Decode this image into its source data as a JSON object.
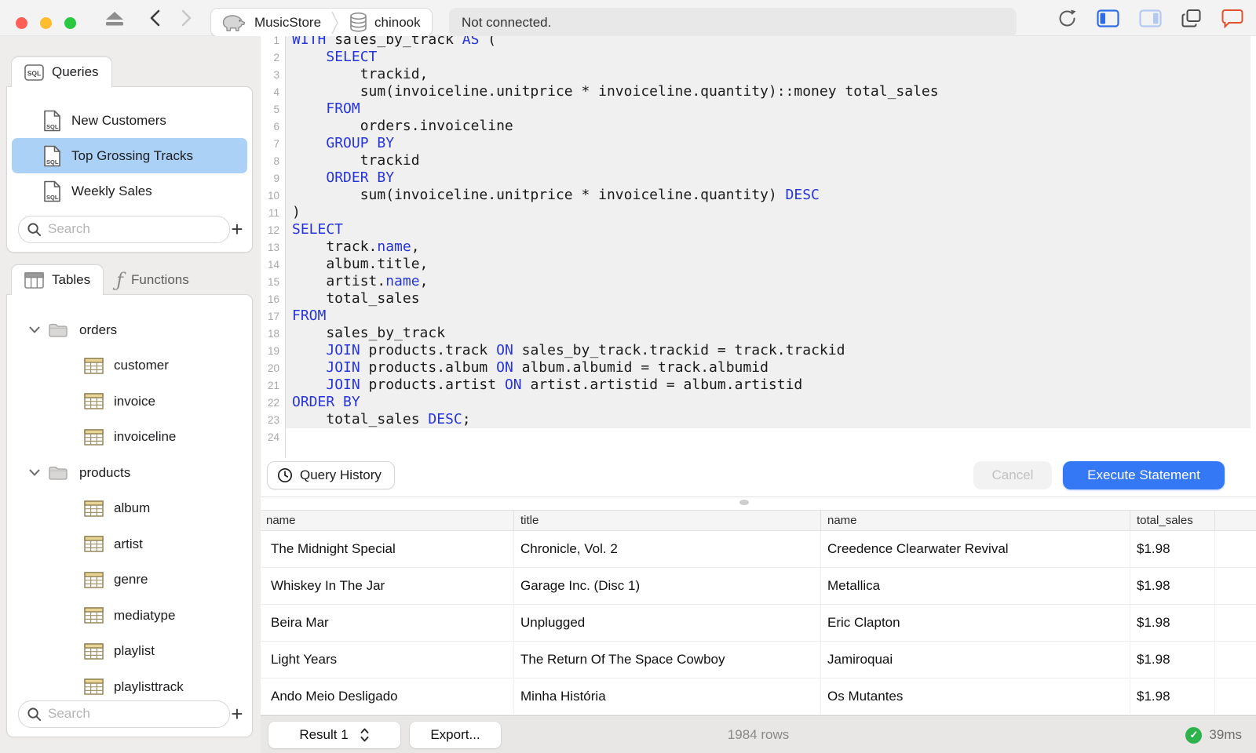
{
  "colors": {
    "accent": "#3478f6",
    "selection_blue": "#abd2f6",
    "keyword_blue": "#2635d9",
    "chat_orange": "#e1512e",
    "success_green": "#2eb24c",
    "traffic_red": "#ff5f57",
    "traffic_yellow": "#febc2e",
    "traffic_green": "#28c840",
    "table_icon_tan": "#e9d597",
    "table_icon_border": "#8e7e4e"
  },
  "titlebar": {
    "breadcrumb": {
      "server": "MusicStore",
      "database": "chinook"
    },
    "status": "Not connected."
  },
  "sidebar": {
    "queries": {
      "tab_label": "Queries",
      "tab_icon": "sql-badge-icon",
      "items": [
        {
          "label": "New Customers",
          "selected": false
        },
        {
          "label": "Top Grossing Tracks",
          "selected": true
        },
        {
          "label": "Weekly Sales",
          "selected": false
        }
      ],
      "search_placeholder": "Search",
      "add_label": "+"
    },
    "tables": {
      "tab_label": "Tables",
      "functions_tab_label": "Functions",
      "tree": [
        {
          "kind": "folder",
          "label": "orders",
          "expanded": true
        },
        {
          "kind": "table",
          "label": "customer"
        },
        {
          "kind": "table",
          "label": "invoice"
        },
        {
          "kind": "table",
          "label": "invoiceline"
        },
        {
          "kind": "folder",
          "label": "products",
          "expanded": true
        },
        {
          "kind": "table",
          "label": "album"
        },
        {
          "kind": "table",
          "label": "artist"
        },
        {
          "kind": "table",
          "label": "genre"
        },
        {
          "kind": "table",
          "label": "mediatype"
        },
        {
          "kind": "table",
          "label": "playlist"
        },
        {
          "kind": "table",
          "label": "playlisttrack"
        }
      ],
      "search_placeholder": "Search",
      "add_label": "+"
    }
  },
  "editor": {
    "lines": [
      [
        [
          "WITH",
          1
        ],
        [
          " sales_by_track ",
          0
        ],
        [
          "AS",
          1
        ],
        [
          " (",
          0
        ]
      ],
      [
        [
          "    ",
          0
        ],
        [
          "SELECT",
          1
        ]
      ],
      [
        [
          "        trackid,",
          0
        ]
      ],
      [
        [
          "        sum(invoiceline.unitprice * invoiceline.quantity)::money total_sales",
          0
        ]
      ],
      [
        [
          "    ",
          0
        ],
        [
          "FROM",
          1
        ]
      ],
      [
        [
          "        orders.invoiceline",
          0
        ]
      ],
      [
        [
          "    ",
          0
        ],
        [
          "GROUP BY",
          1
        ]
      ],
      [
        [
          "        trackid",
          0
        ]
      ],
      [
        [
          "    ",
          0
        ],
        [
          "ORDER BY",
          1
        ]
      ],
      [
        [
          "        sum(invoiceline.unitprice * invoiceline.quantity) ",
          0
        ],
        [
          "DESC",
          1
        ]
      ],
      [
        [
          ")",
          0
        ]
      ],
      [
        [
          "SELECT",
          1
        ]
      ],
      [
        [
          "    track.",
          0
        ],
        [
          "name",
          1
        ],
        [
          ",",
          0
        ]
      ],
      [
        [
          "    album.title,",
          0
        ]
      ],
      [
        [
          "    artist.",
          0
        ],
        [
          "name",
          1
        ],
        [
          ",",
          0
        ]
      ],
      [
        [
          "    total_sales",
          0
        ]
      ],
      [
        [
          "FROM",
          1
        ]
      ],
      [
        [
          "    sales_by_track",
          0
        ]
      ],
      [
        [
          "    ",
          0
        ],
        [
          "JOIN",
          1
        ],
        [
          " products.track ",
          0
        ],
        [
          "ON",
          1
        ],
        [
          " sales_by_track.trackid = track.trackid",
          0
        ]
      ],
      [
        [
          "    ",
          0
        ],
        [
          "JOIN",
          1
        ],
        [
          " products.album ",
          0
        ],
        [
          "ON",
          1
        ],
        [
          " album.albumid = track.albumid",
          0
        ]
      ],
      [
        [
          "    ",
          0
        ],
        [
          "JOIN",
          1
        ],
        [
          " products.artist ",
          0
        ],
        [
          "ON",
          1
        ],
        [
          " artist.artistid = album.artistid",
          0
        ]
      ],
      [
        [
          "ORDER BY",
          1
        ]
      ],
      [
        [
          "    total_sales ",
          0
        ],
        [
          "DESC",
          1
        ],
        [
          ";",
          0
        ]
      ],
      []
    ],
    "query_history_label": "Query History",
    "cancel_label": "Cancel",
    "execute_label": "Execute Statement"
  },
  "results": {
    "columns": [
      "name",
      "title",
      "name",
      "total_sales"
    ],
    "rows": [
      [
        "The Midnight Special",
        "Chronicle, Vol. 2",
        "Creedence Clearwater Revival",
        "$1.98"
      ],
      [
        "Whiskey In The Jar",
        "Garage Inc. (Disc 1)",
        "Metallica",
        "$1.98"
      ],
      [
        "Beira Mar",
        "Unplugged",
        "Eric Clapton",
        "$1.98"
      ],
      [
        "Light Years",
        "The Return Of The Space Cowboy",
        "Jamiroquai",
        "$1.98"
      ],
      [
        "Ando Meio Desligado",
        "Minha História",
        "Os Mutantes",
        "$1.98"
      ]
    ]
  },
  "statusbar": {
    "result_selector": "Result 1",
    "export_label": "Export...",
    "row_count": "1984 rows",
    "duration": "39ms"
  }
}
